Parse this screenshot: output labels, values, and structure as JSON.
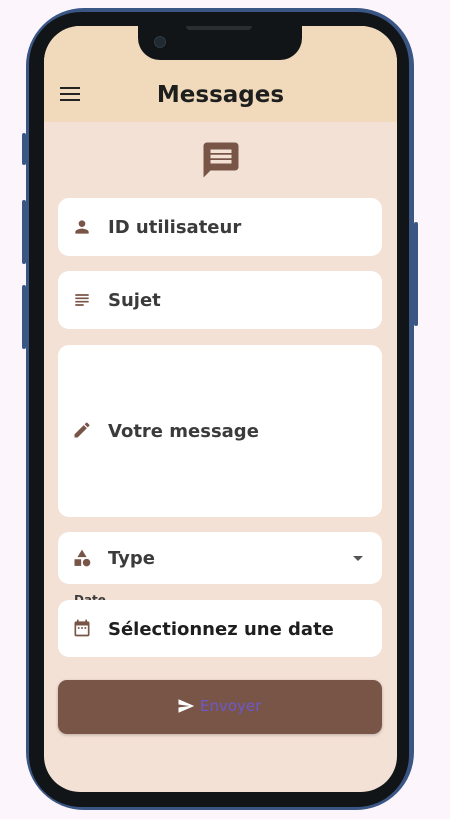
{
  "app": {
    "title": "Messages"
  },
  "form": {
    "user_id": {
      "placeholder": "ID utilisateur"
    },
    "subject": {
      "placeholder": "Sujet"
    },
    "message": {
      "placeholder": "Votre message"
    },
    "type": {
      "placeholder": "Type"
    },
    "date": {
      "caption": "Date",
      "placeholder": "Sélectionnez une date"
    },
    "submit": {
      "label": "Envoyer"
    }
  },
  "colors": {
    "appbar": "#f0dabb",
    "background": "#f4e1d6",
    "accent": "#795548",
    "button_text": "#6d58c9",
    "phone_frame": "#3a5685"
  },
  "icons": [
    "menu-icon",
    "message-icon",
    "person-icon",
    "subject-icon",
    "edit-icon",
    "category-icon",
    "dropdown-arrow-icon",
    "calendar-icon",
    "send-icon"
  ]
}
